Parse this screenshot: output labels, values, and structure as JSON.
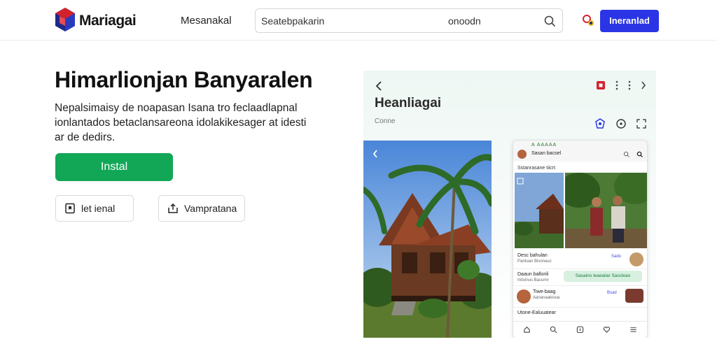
{
  "header": {
    "brand": "Mariagai",
    "nav_link": "Mesanakal",
    "search": {
      "value": "Seatebpakarin",
      "hint": "onoodn"
    },
    "cta_label": "Ineranlad"
  },
  "hero": {
    "title": "Himarlionjan Banyaralen",
    "description": "Nepalsimaisy de noapasan Isana tro feclaadlapnal ionlantados betaclansareona idolakikesager at idesti ar de dedirs.",
    "install_label": "Instal",
    "secondary_buttons": [
      {
        "label": "let ienal"
      },
      {
        "label": "Vampratana"
      }
    ]
  },
  "panel": {
    "title": "Heanliagai",
    "subtitle": "Conne",
    "phone": {
      "status_text": "A AAAAA",
      "contact_name": "Sasan bacsel",
      "sub_header": "Sstanrasane tiicrt",
      "posts": [
        {
          "title": "Desc bahulan",
          "meta": "Pantuan Bivonauc",
          "dot": "Sado"
        },
        {
          "title": "Daaun ballonli",
          "meta": "Intivinus Bacurnr",
          "pill": "Sasaino leaeaiiar Sascleao"
        },
        {
          "title": "Tiwe-baag",
          "meta": "Aananaakioua",
          "dot": "Bsad"
        },
        {
          "title": "Utone-Ealuuatear",
          "meta": ""
        }
      ]
    }
  },
  "colors": {
    "accent_blue": "#2b35e6",
    "install_green": "#12a757",
    "logo_blue": "#1e2a8a",
    "logo_red": "#d3222e"
  },
  "icons": [
    "mariagai-logo",
    "search-icon",
    "palette-icon",
    "bookmark-icon",
    "upload-icon",
    "chevron-left-icon",
    "record-icon",
    "more-icon",
    "chevron-right-icon",
    "shield-icon",
    "settings-icon",
    "expand-icon",
    "home-icon",
    "message-icon",
    "heart-icon",
    "menu-icon"
  ]
}
